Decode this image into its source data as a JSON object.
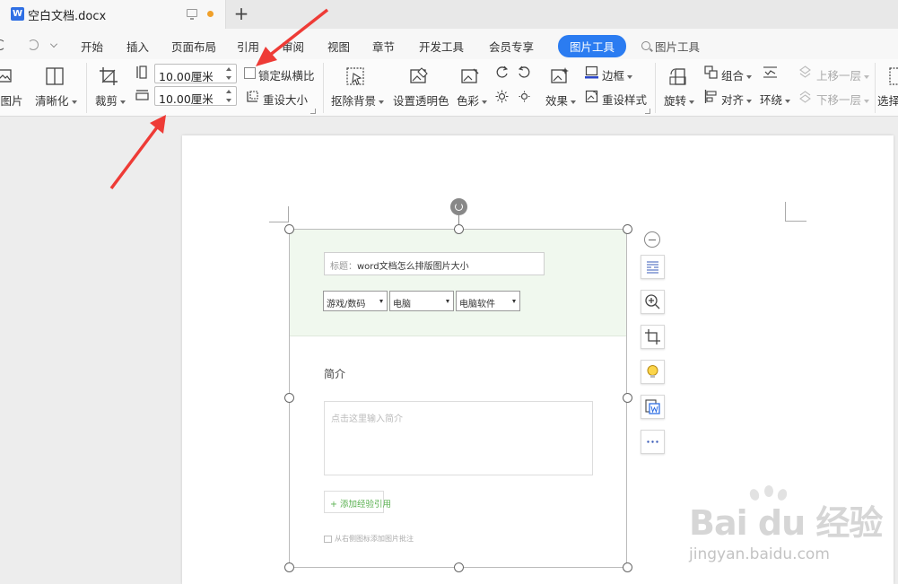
{
  "titlebar": {
    "doc_title": "空白文档.docx",
    "logo_letter": "W",
    "new_tab": "+"
  },
  "menubar": {
    "items": [
      "开始",
      "插入",
      "页面布局",
      "引用",
      "审阅",
      "视图",
      "章节",
      "开发工具",
      "会员专享",
      "图片工具"
    ],
    "active_item": "图片工具",
    "search_label": "图片工具"
  },
  "ribbon": {
    "buttons": {
      "picture": "换图片",
      "sharpen": "清晰化",
      "crop": "裁剪",
      "lock_ratio": "锁定纵横比",
      "reset_size": "重设大小",
      "remove_bg": "抠除背景",
      "set_transparent": "设置透明色",
      "color": "色彩",
      "effect": "效果",
      "border": "边框",
      "reset_style": "重设样式",
      "rotate": "旋转",
      "group": "组合",
      "align": "对齐",
      "wrap": "环绕",
      "bring_forward": "上移一层",
      "send_backward": "下移一层",
      "select": "选择"
    },
    "width_value": "10.00厘米",
    "height_value": "10.00厘米",
    "lock_ratio_checked": false
  },
  "image_content": {
    "title_label": "标题：",
    "title_value": "word文档怎么排版图片大小",
    "selects": [
      "游戏/数码",
      "电脑",
      "电脑软件"
    ],
    "intro_label": "简介",
    "intro_placeholder": "点击这里输入简介",
    "add_button": "+ 添加经验引用",
    "source_note": "从右侧图标添加图片批注"
  },
  "watermark": {
    "logo": "Bai du 经验",
    "url": "jingyan.baidu.com"
  },
  "colors": {
    "accent": "#2b7cf1",
    "annotation_arrow": "#ee3b36",
    "image_header_bg": "#f0f8ee",
    "add_button_text": "#59b04f"
  }
}
